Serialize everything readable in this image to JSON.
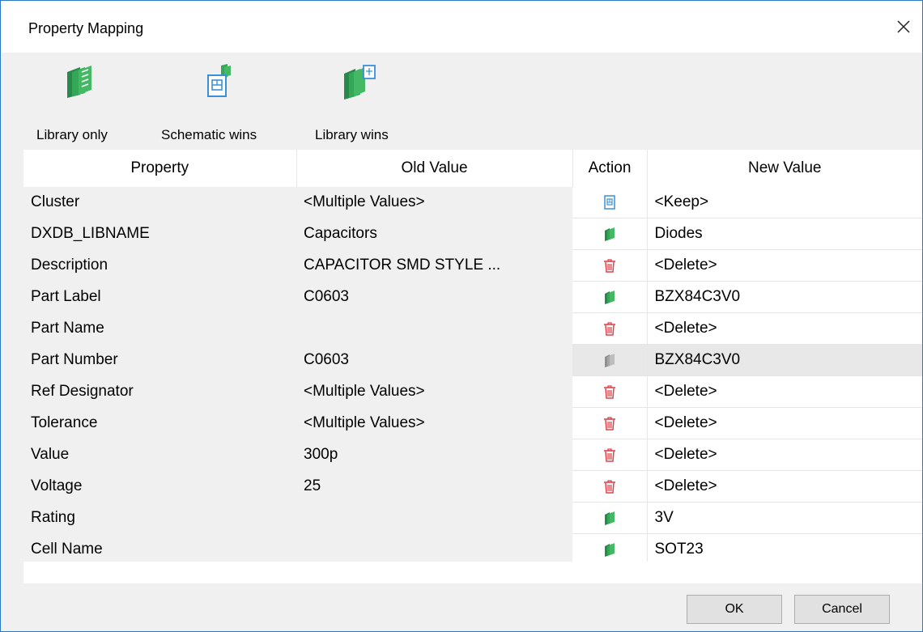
{
  "window": {
    "title": "Property Mapping"
  },
  "toolbar": {
    "library_only": "Library only",
    "schematic_wins": "Schematic wins",
    "library_wins": "Library wins"
  },
  "table": {
    "headers": [
      "Property",
      "Old Value",
      "Action",
      "New Value"
    ],
    "rows": [
      {
        "property": "Cluster",
        "old_value": "<Multiple Values>",
        "action": "schematic-icon",
        "new_value": "<Keep>"
      },
      {
        "property": "DXDB_LIBNAME",
        "old_value": "Capacitors",
        "action": "library-icon",
        "new_value": "Diodes"
      },
      {
        "property": "Description",
        "old_value": "CAPACITOR SMD STYLE ...",
        "action": "delete-icon",
        "new_value": "<Delete>"
      },
      {
        "property": "Part Label",
        "old_value": "C0603",
        "action": "library-icon",
        "new_value": "BZX84C3V0"
      },
      {
        "property": "Part Name",
        "old_value": "",
        "action": "delete-icon",
        "new_value": "<Delete>"
      },
      {
        "property": "Part Number",
        "old_value": "C0603",
        "action": "library-gray-icon",
        "new_value": "BZX84C3V0"
      },
      {
        "property": "Ref Designator",
        "old_value": "<Multiple Values>",
        "action": "delete-icon",
        "new_value": "<Delete>"
      },
      {
        "property": "Tolerance",
        "old_value": "<Multiple Values>",
        "action": "delete-icon",
        "new_value": "<Delete>"
      },
      {
        "property": "Value",
        "old_value": "300p",
        "action": "delete-icon",
        "new_value": "<Delete>"
      },
      {
        "property": "Voltage",
        "old_value": "25",
        "action": "delete-icon",
        "new_value": "<Delete>"
      },
      {
        "property": "Rating",
        "old_value": "",
        "action": "library-icon",
        "new_value": "3V"
      },
      {
        "property": "Cell Name",
        "old_value": "",
        "action": "library-icon",
        "new_value": "SOT23"
      }
    ]
  },
  "buttons": {
    "ok": "OK",
    "cancel": "Cancel"
  },
  "colors": {
    "library_green": "#2e9a4f",
    "schematic_blue": "#3b8fd6",
    "delete_red": "#d9424b",
    "gray_icon": "#a6a6a6"
  }
}
